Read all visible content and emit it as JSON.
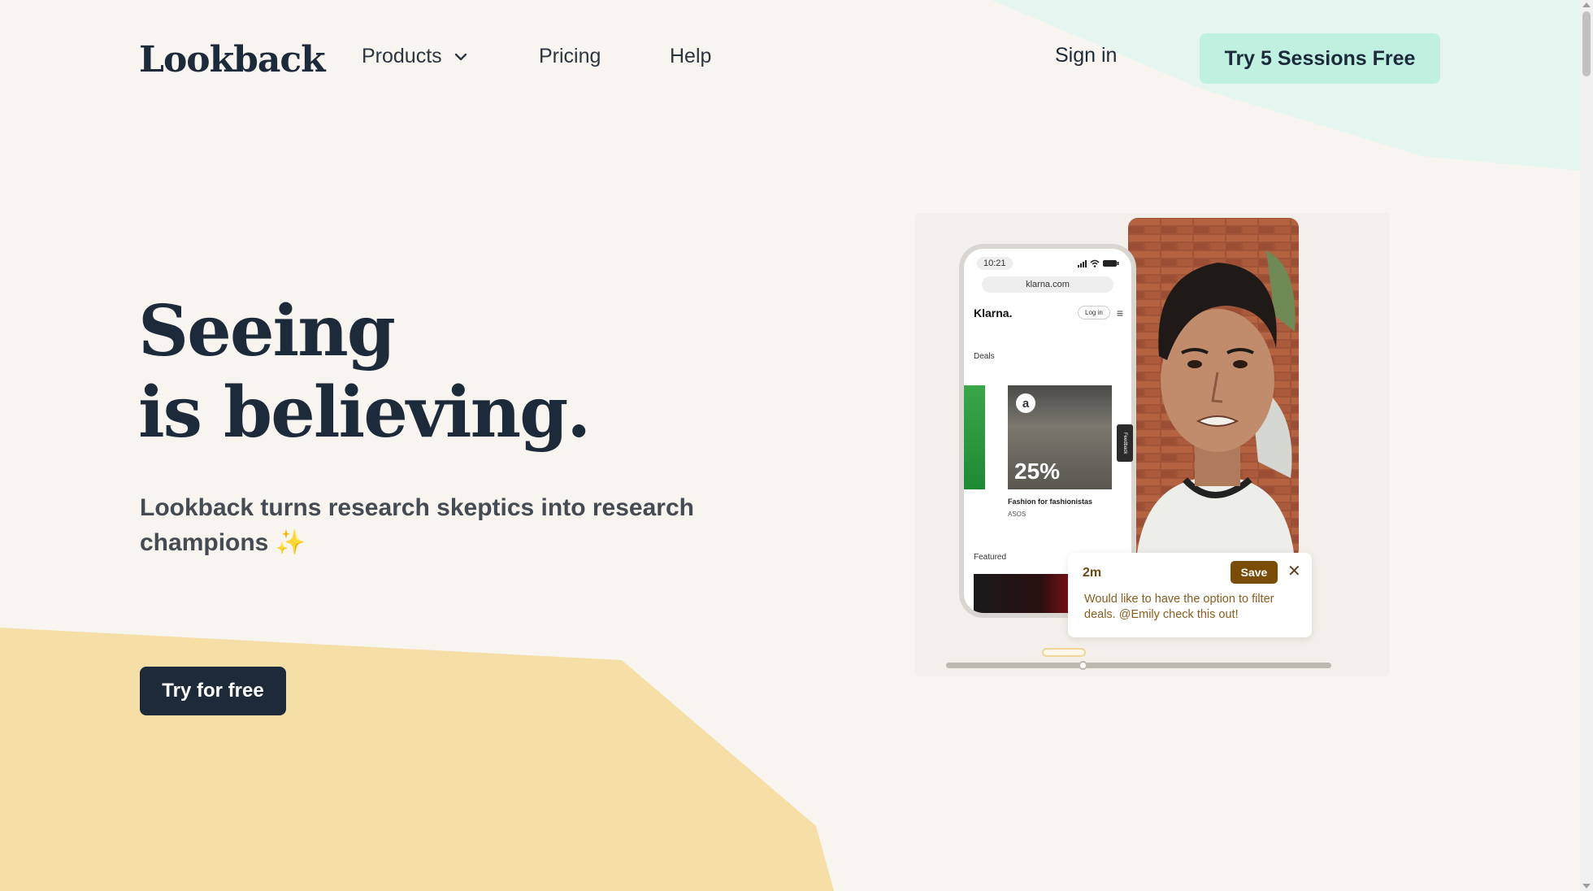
{
  "header": {
    "logo": "Lookback",
    "nav": [
      {
        "label": "Products",
        "has_dropdown": true
      },
      {
        "label": "Pricing"
      },
      {
        "label": "Help"
      }
    ],
    "signin": "Sign in",
    "cta": "Try 5 Sessions Free"
  },
  "hero": {
    "headline_line1": "Seeing",
    "headline_line2": "is believing.",
    "subhead": "Lookback turns research skeptics into research champions",
    "sparkle": "✨",
    "cta": "Try for free"
  },
  "illustration": {
    "phone": {
      "time": "10:21",
      "url": "klarna.com",
      "brand": "Klarna.",
      "login": "Log in",
      "deals_label": "Deals",
      "deal_discount": "25%",
      "deal_logo": "a",
      "deal_title": "Fashion for fashionistas",
      "deal_brand": "ASOS",
      "featured_label": "Featured",
      "feedback_tab": "Feedback"
    },
    "comment": {
      "time": "2m",
      "save": "Save",
      "text": "Would like to have the option to filter deals. @Emily check this out!"
    }
  },
  "colors": {
    "background": "#f8f4ef",
    "mint": "#bff0e0",
    "sand": "#f6dfa6",
    "navy": "#1c2a3a",
    "save_brown": "#7a4d07"
  }
}
